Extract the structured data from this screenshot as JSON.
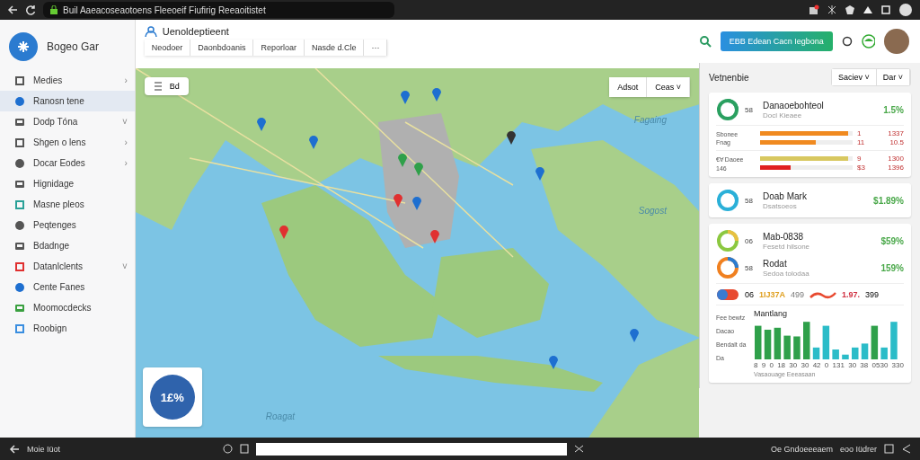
{
  "browser": {
    "url": "Buil Aaeacoseaotoens Fleeoeif Fiufirig Reeaoitistet"
  },
  "sidebar": {
    "brand": "Bogeo Gar",
    "items": [
      {
        "label": "Medies",
        "chevron": "›",
        "selected": false,
        "color": "#555555"
      },
      {
        "label": "Ranosn tene",
        "selected": true,
        "color": "#1e6fd0"
      },
      {
        "label": "Dodp Tóna",
        "chevron": "˅",
        "selected": false,
        "color": "#555555"
      },
      {
        "label": "Shgen o lens",
        "chevron": "›",
        "selected": false,
        "color": "#555555"
      },
      {
        "label": "Docar Eodes",
        "chevron": "›",
        "selected": false,
        "color": "#555555"
      },
      {
        "label": "Hignidage",
        "selected": false,
        "color": "#555555"
      },
      {
        "label": "Masne pleos",
        "selected": false,
        "color": "#2aa198"
      },
      {
        "label": "Peqtenges",
        "selected": false,
        "color": "#555555"
      },
      {
        "label": "Bdadnge",
        "selected": false,
        "color": "#555555"
      },
      {
        "label": "Datanlclents",
        "chevron": "˅",
        "selected": false,
        "color": "#e03030"
      },
      {
        "label": "Cente Fanes",
        "selected": false,
        "color": "#1e6fd0"
      },
      {
        "label": "Moomocdecks",
        "selected": false,
        "color": "#3aa040"
      },
      {
        "label": "Roobign",
        "selected": false,
        "color": "#3a8ee0"
      }
    ]
  },
  "header": {
    "title": "Uenoldeptieent",
    "tabs": [
      {
        "label": "Neodoer",
        "selected": false
      },
      {
        "label": "Daonbdoanis",
        "selected": false
      },
      {
        "label": "Reporloar",
        "selected": false
      },
      {
        "label": "Nasde d.Cle",
        "selected": false
      }
    ],
    "more": "···",
    "action_button": "EBB  Edean Cacn Iegbona"
  },
  "map": {
    "control": "Bd",
    "buttons": [
      "Adsot",
      "Ceas ˅"
    ],
    "labels": [
      "Fagaing",
      "Sogost",
      "Roagat"
    ],
    "badge": "1£%"
  },
  "panel": {
    "title": "Vetnenbie",
    "filters": [
      "Saciev ˅",
      "Dar ˅"
    ],
    "card1": {
      "donut_label": "58",
      "title": "Danaoebohteol",
      "subtitle": "Docl Kieaee",
      "value": "1.5%",
      "rows": [
        {
          "label": "Sbonee",
          "sublabel": "Fnag",
          "bars": [
            {
              "level": 0.95,
              "color": "#f08a20"
            },
            {
              "level": 0.6,
              "color": "#f08a20"
            }
          ],
          "values": [
            [
              "1",
              "1337"
            ],
            [
              "11",
              "10.5"
            ]
          ]
        },
        {
          "label": "€Ɐ Daoee",
          "sublabel": "146",
          "bars": [
            {
              "level": 0.95,
              "color": "#d8c860"
            },
            {
              "level": 0.33,
              "color": "#e02020"
            }
          ],
          "values": [
            [
              "9",
              "1300"
            ],
            [
              "$3",
              "1396"
            ]
          ]
        }
      ]
    },
    "card2": {
      "donut_label": "58",
      "title": "Doab Mark",
      "subtitle": "Dsatsoeos",
      "value": "$1.89%"
    },
    "card3": {
      "items": [
        {
          "donut_label": "06",
          "title": "Mab-0838",
          "subtitle": "Fesetd hilsone",
          "value": "$59%"
        },
        {
          "donut_label": "58",
          "title": "Rodat",
          "subtitle": "Sedoa tolodaa",
          "value": "159%"
        }
      ],
      "pill": {
        "label": "06",
        "value1": "1IJ37A",
        "value2": "499",
        "value3": "1.97.",
        "value4": "399"
      },
      "chart": {
        "title": "Mantlang",
        "side_labels": [
          "Fee bewtz",
          "Dacao",
          "Bendalt da",
          "Da"
        ],
        "x_labels": [
          "8",
          "9",
          "0",
          "18",
          "30",
          "30",
          "42",
          "0",
          "131",
          "30",
          "38",
          "0530",
          "330"
        ],
        "footer": "Vasaouage Eeeasaan"
      }
    }
  },
  "bottom": {
    "left": "Moie Iüot",
    "right1": "Oe Gndoeeeaem",
    "right2": "eoo Iüdrer"
  }
}
